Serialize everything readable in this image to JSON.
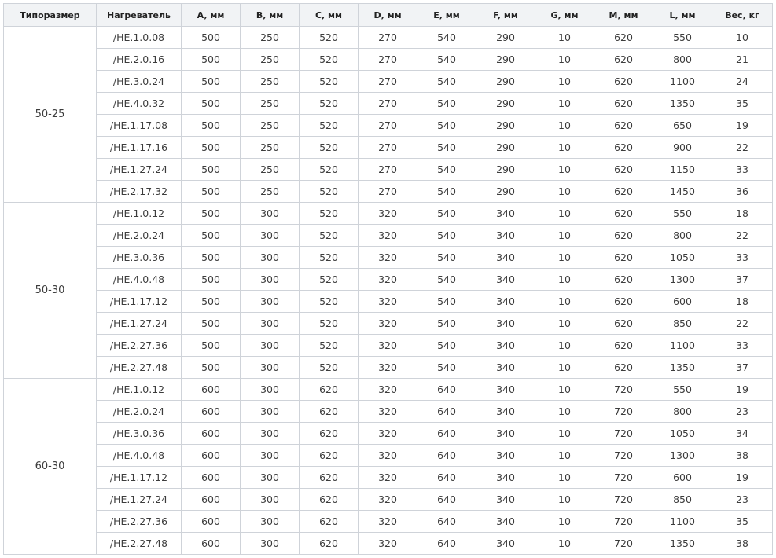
{
  "headers": [
    "Типоразмер",
    "Нагреватель",
    "A, мм",
    "B, мм",
    "C, мм",
    "D, мм",
    "E, мм",
    "F, мм",
    "G, мм",
    "M, мм",
    "L, мм",
    "Вес, кг"
  ],
  "groups": [
    {
      "type": "50-25",
      "rows": [
        [
          "/HE.1.0.08",
          "500",
          "250",
          "520",
          "270",
          "540",
          "290",
          "10",
          "620",
          "550",
          "10"
        ],
        [
          "/HE.2.0.16",
          "500",
          "250",
          "520",
          "270",
          "540",
          "290",
          "10",
          "620",
          "800",
          "21"
        ],
        [
          "/HE.3.0.24",
          "500",
          "250",
          "520",
          "270",
          "540",
          "290",
          "10",
          "620",
          "1100",
          "24"
        ],
        [
          "/HE.4.0.32",
          "500",
          "250",
          "520",
          "270",
          "540",
          "290",
          "10",
          "620",
          "1350",
          "35"
        ],
        [
          "/HE.1.17.08",
          "500",
          "250",
          "520",
          "270",
          "540",
          "290",
          "10",
          "620",
          "650",
          "19"
        ],
        [
          "/HE.1.17.16",
          "500",
          "250",
          "520",
          "270",
          "540",
          "290",
          "10",
          "620",
          "900",
          "22"
        ],
        [
          "/HE.1.27.24",
          "500",
          "250",
          "520",
          "270",
          "540",
          "290",
          "10",
          "620",
          "1150",
          "33"
        ],
        [
          "/HE.2.17.32",
          "500",
          "250",
          "520",
          "270",
          "540",
          "290",
          "10",
          "620",
          "1450",
          "36"
        ]
      ]
    },
    {
      "type": "50-30",
      "rows": [
        [
          "/HE.1.0.12",
          "500",
          "300",
          "520",
          "320",
          "540",
          "340",
          "10",
          "620",
          "550",
          "18"
        ],
        [
          "/HE.2.0.24",
          "500",
          "300",
          "520",
          "320",
          "540",
          "340",
          "10",
          "620",
          "800",
          "22"
        ],
        [
          "/HE.3.0.36",
          "500",
          "300",
          "520",
          "320",
          "540",
          "340",
          "10",
          "620",
          "1050",
          "33"
        ],
        [
          "/HE.4.0.48",
          "500",
          "300",
          "520",
          "320",
          "540",
          "340",
          "10",
          "620",
          "1300",
          "37"
        ],
        [
          "/HE.1.17.12",
          "500",
          "300",
          "520",
          "320",
          "540",
          "340",
          "10",
          "620",
          "600",
          "18"
        ],
        [
          "/HE.1.27.24",
          "500",
          "300",
          "520",
          "320",
          "540",
          "340",
          "10",
          "620",
          "850",
          "22"
        ],
        [
          "/HE.2.27.36",
          "500",
          "300",
          "520",
          "320",
          "540",
          "340",
          "10",
          "620",
          "1100",
          "33"
        ],
        [
          "/HE.2.27.48",
          "500",
          "300",
          "520",
          "320",
          "540",
          "340",
          "10",
          "620",
          "1350",
          "37"
        ]
      ]
    },
    {
      "type": "60-30",
      "rows": [
        [
          "/HE.1.0.12",
          "600",
          "300",
          "620",
          "320",
          "640",
          "340",
          "10",
          "720",
          "550",
          "19"
        ],
        [
          "/HE.2.0.24",
          "600",
          "300",
          "620",
          "320",
          "640",
          "340",
          "10",
          "720",
          "800",
          "23"
        ],
        [
          "/HE.3.0.36",
          "600",
          "300",
          "620",
          "320",
          "640",
          "340",
          "10",
          "720",
          "1050",
          "34"
        ],
        [
          "/HE.4.0.48",
          "600",
          "300",
          "620",
          "320",
          "640",
          "340",
          "10",
          "720",
          "1300",
          "38"
        ],
        [
          "/HE.1.17.12",
          "600",
          "300",
          "620",
          "320",
          "640",
          "340",
          "10",
          "720",
          "600",
          "19"
        ],
        [
          "/HE.1.27.24",
          "600",
          "300",
          "620",
          "320",
          "640",
          "340",
          "10",
          "720",
          "850",
          "23"
        ],
        [
          "/HE.2.27.36",
          "600",
          "300",
          "620",
          "320",
          "640",
          "340",
          "10",
          "720",
          "1100",
          "35"
        ],
        [
          "/HE.2.27.48",
          "600",
          "300",
          "620",
          "320",
          "640",
          "340",
          "10",
          "720",
          "1350",
          "38"
        ]
      ]
    }
  ]
}
